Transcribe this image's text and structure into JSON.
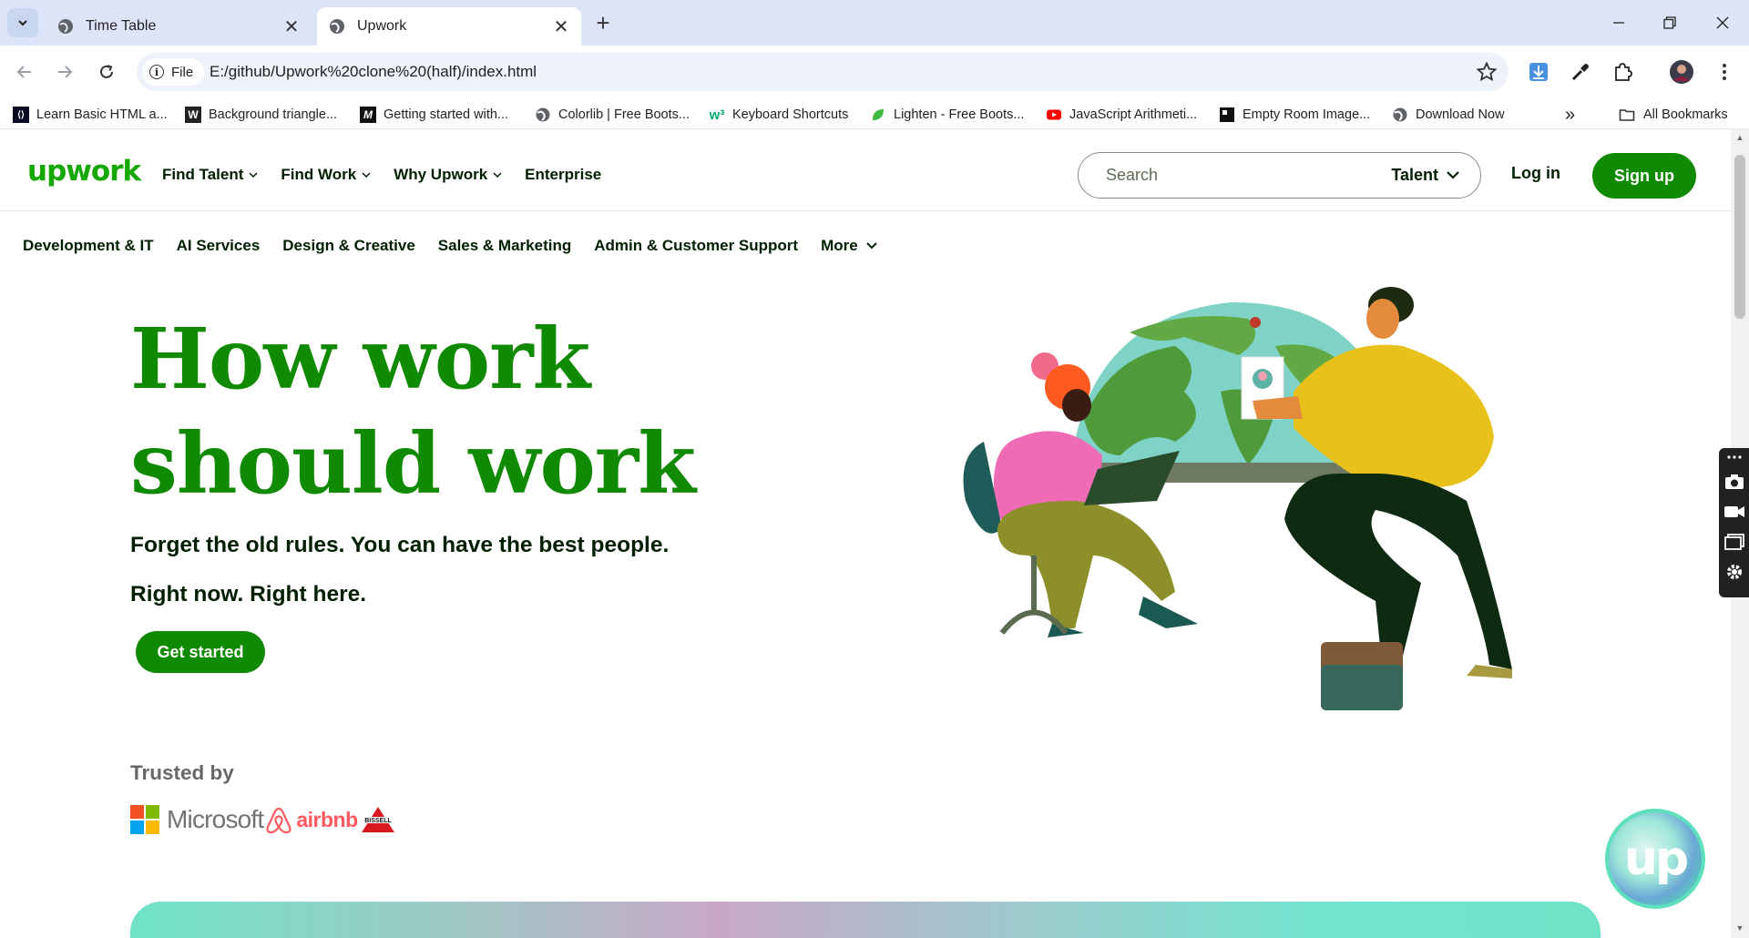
{
  "browser": {
    "tabs": [
      {
        "title": "Time Table",
        "active": false
      },
      {
        "title": "Upwork",
        "active": true
      }
    ],
    "address": {
      "chip": "File",
      "url": "E:/github/Upwork%20clone%20(half)/index.html"
    },
    "bookmarks": [
      {
        "label": "Learn Basic HTML a...",
        "icon": "code-icon"
      },
      {
        "label": "Background triangle...",
        "icon": "w-icon"
      },
      {
        "label": "Getting started with...",
        "icon": "m-icon"
      },
      {
        "label": "Colorlib | Free Boots...",
        "icon": "globe-icon"
      },
      {
        "label": "Keyboard Shortcuts",
        "icon": "w3-icon"
      },
      {
        "label": "Lighten - Free Boots...",
        "icon": "leaf-icon"
      },
      {
        "label": "JavaScript Arithmeti...",
        "icon": "youtube-icon"
      },
      {
        "label": "Empty Room Image...",
        "icon": "square-icon"
      },
      {
        "label": "Download Now",
        "icon": "globe-icon"
      }
    ],
    "bookmarks_overflow": "»",
    "all_bookmarks": "All Bookmarks"
  },
  "site": {
    "logo": "upwork",
    "nav": [
      "Find Talent",
      "Find Work",
      "Why Upwork",
      "Enterprise"
    ],
    "search_placeholder": "Search",
    "search_scope": "Talent",
    "login": "Log in",
    "signup": "Sign up",
    "categories": [
      "Development & IT",
      "AI Services",
      "Design & Creative",
      "Sales & Marketing",
      "Admin & Customer Support",
      "More"
    ],
    "hero": {
      "title_line1": "How work",
      "title_line2": "should work",
      "sub1": "Forget the old rules. You can have the best people.",
      "sub2": "Right now. Right here.",
      "cta": "Get started"
    },
    "trusted_by": "Trusted by",
    "trusted_logos": {
      "microsoft": "Microsoft",
      "airbnb": "airbnb",
      "bissell": "BISSELL"
    },
    "badge": "up"
  },
  "colors": {
    "brand_green": "#108a00",
    "logo_green": "#14a800",
    "chrome_tabbar": "#dce5f7"
  }
}
